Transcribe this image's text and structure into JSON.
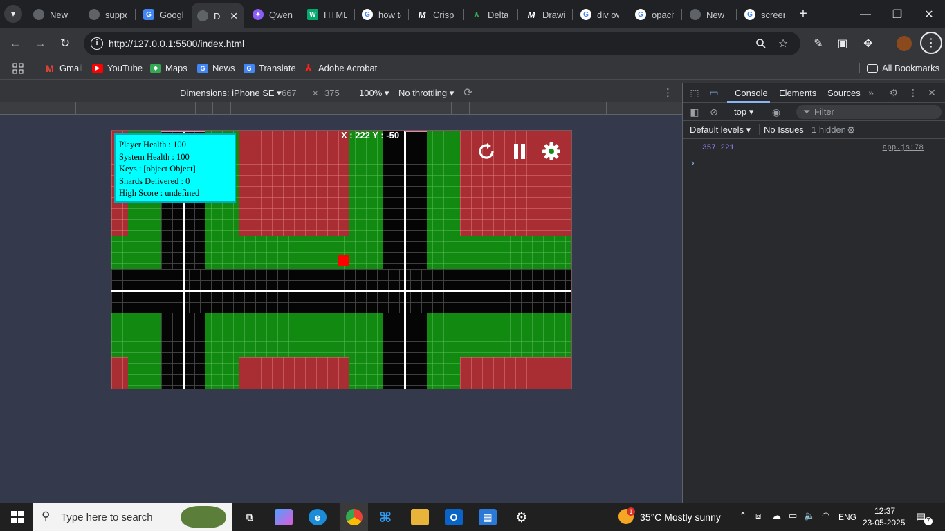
{
  "browser": {
    "tabs": [
      {
        "label": "New T",
        "icon": "chrome-icon",
        "color": "#9aa0a6"
      },
      {
        "label": "suppo",
        "icon": "globe-icon",
        "color": "#9aa0a6"
      },
      {
        "label": "Googl",
        "icon": "google-news-icon",
        "color": "#4285f4"
      },
      {
        "label": "D",
        "icon": "globe-icon",
        "color": "#9aa0a6",
        "active": true
      },
      {
        "label": "Qwen",
        "icon": "qwen-icon",
        "color": "#8b5cf6"
      },
      {
        "label": "HTML",
        "icon": "w3-icon",
        "color": "#04aa6d"
      },
      {
        "label": "how to",
        "icon": "google-icon",
        "color": "#4285f4"
      },
      {
        "label": "Crisp",
        "icon": "m-icon",
        "color": "#ffffff"
      },
      {
        "label": "Delta",
        "icon": "delta-icon",
        "color": "#34a853"
      },
      {
        "label": "Drawi",
        "icon": "m-icon",
        "color": "#ffffff"
      },
      {
        "label": "div ov",
        "icon": "google-icon",
        "color": "#4285f4"
      },
      {
        "label": "opacit",
        "icon": "google-icon",
        "color": "#4285f4"
      },
      {
        "label": "New T",
        "icon": "chrome-icon",
        "color": "#9aa0a6"
      },
      {
        "label": "screen",
        "icon": "google-icon",
        "color": "#4285f4"
      }
    ],
    "url": "http://127.0.0.1:5500/index.html",
    "bookmarks": [
      {
        "label": "Gmail",
        "icon": "gmail-icon",
        "color": "#ea4335"
      },
      {
        "label": "YouTube",
        "icon": "youtube-icon",
        "color": "#ff0000"
      },
      {
        "label": "Maps",
        "icon": "maps-icon",
        "color": "#34a853"
      },
      {
        "label": "News",
        "icon": "news-icon",
        "color": "#4285f4"
      },
      {
        "label": "Translate",
        "icon": "translate-icon",
        "color": "#4285f4"
      },
      {
        "label": "Adobe Acrobat",
        "icon": "acrobat-icon",
        "color": "#ff2116"
      }
    ],
    "all_bookmarks": "All Bookmarks"
  },
  "device_toolbar": {
    "dimensions": "Dimensions: iPhone SE",
    "width": "667",
    "times": "×",
    "height": "375",
    "zoom": "100%",
    "throttling": "No throttling"
  },
  "game": {
    "hud": {
      "player_health": "Player Health : 100",
      "system_health": "System Health : 100",
      "keys": "Keys : [object Object]",
      "shards": "Shards Delivered : 0",
      "high_score": "High Score : undefined"
    },
    "coords": "X : 222 Y : -50",
    "colors": {
      "wall": "#a82e33",
      "grass": "#128a12",
      "road": "#050505",
      "player": "#ff0000",
      "hud": "#00ffff"
    }
  },
  "devtools": {
    "tabs": [
      "Console",
      "Elements",
      "Sources"
    ],
    "context": "top",
    "filter_placeholder": "Filter",
    "levels": "Default levels",
    "issues": "No Issues",
    "hidden": "1 hidden",
    "log_message": "357 221",
    "log_source": "app.js:78",
    "prompt": "›"
  },
  "taskbar": {
    "search_placeholder": "Type here to search",
    "weather": "35°C  Mostly sunny",
    "weather_badge": "1",
    "language": "ENG",
    "time": "12:37",
    "date": "23-05-2025",
    "notifications": "7"
  }
}
